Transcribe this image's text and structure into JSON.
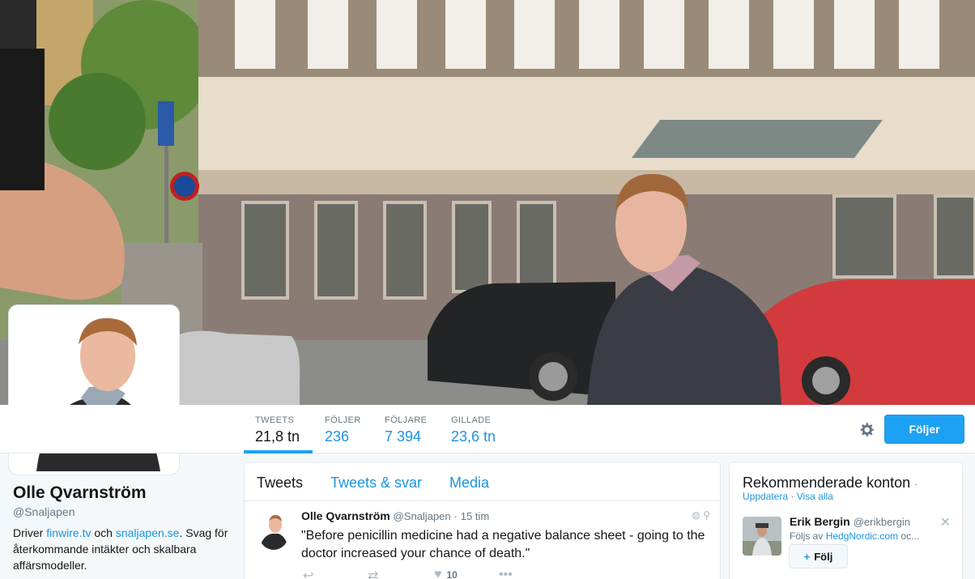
{
  "profile": {
    "name": "Olle Qvarnström",
    "handle": "@Snaljapen",
    "bio_prefix": "Driver ",
    "bio_link1": "finwire.tv",
    "bio_mid": " och ",
    "bio_link2": "snaljapen.se",
    "bio_suffix": ". Svag för återkommande intäkter och skalbara affärsmodeller."
  },
  "stats": [
    {
      "label": "TWEETS",
      "value": "21,8 tn"
    },
    {
      "label": "FÖLJER",
      "value": "236"
    },
    {
      "label": "FÖLJARE",
      "value": "7 394"
    },
    {
      "label": "GILLADE",
      "value": "23,6 tn"
    }
  ],
  "actions": {
    "follow_label": "Följer",
    "gear_icon": "gear-icon"
  },
  "timeline": {
    "tabs": [
      "Tweets",
      "Tweets & svar",
      "Media"
    ],
    "tweet": {
      "name": "Olle Qvarnström",
      "username": "@Snaljapen",
      "dot": "·",
      "time": "15 tim",
      "text": "\"Before penicillin medicine had a negative balance sheet - going to the doctor increased your chance of death.\"",
      "like_count": "10"
    }
  },
  "recommendations": {
    "title": "Rekommenderade konton",
    "title_sep": "·",
    "refresh": "Uppdatera",
    "links_sep": " · ",
    "view_all": "Visa alla",
    "account": {
      "name": "Erik Bergin",
      "username": "@erikbergin",
      "followed_prefix": "Följs av ",
      "followed_by": "HedgNordic.com",
      "followed_suffix": " oc...",
      "follow_label": "Följ"
    }
  },
  "colors": {
    "accent": "#1da1f2",
    "link": "#1b95e0",
    "muted": "#657786"
  }
}
